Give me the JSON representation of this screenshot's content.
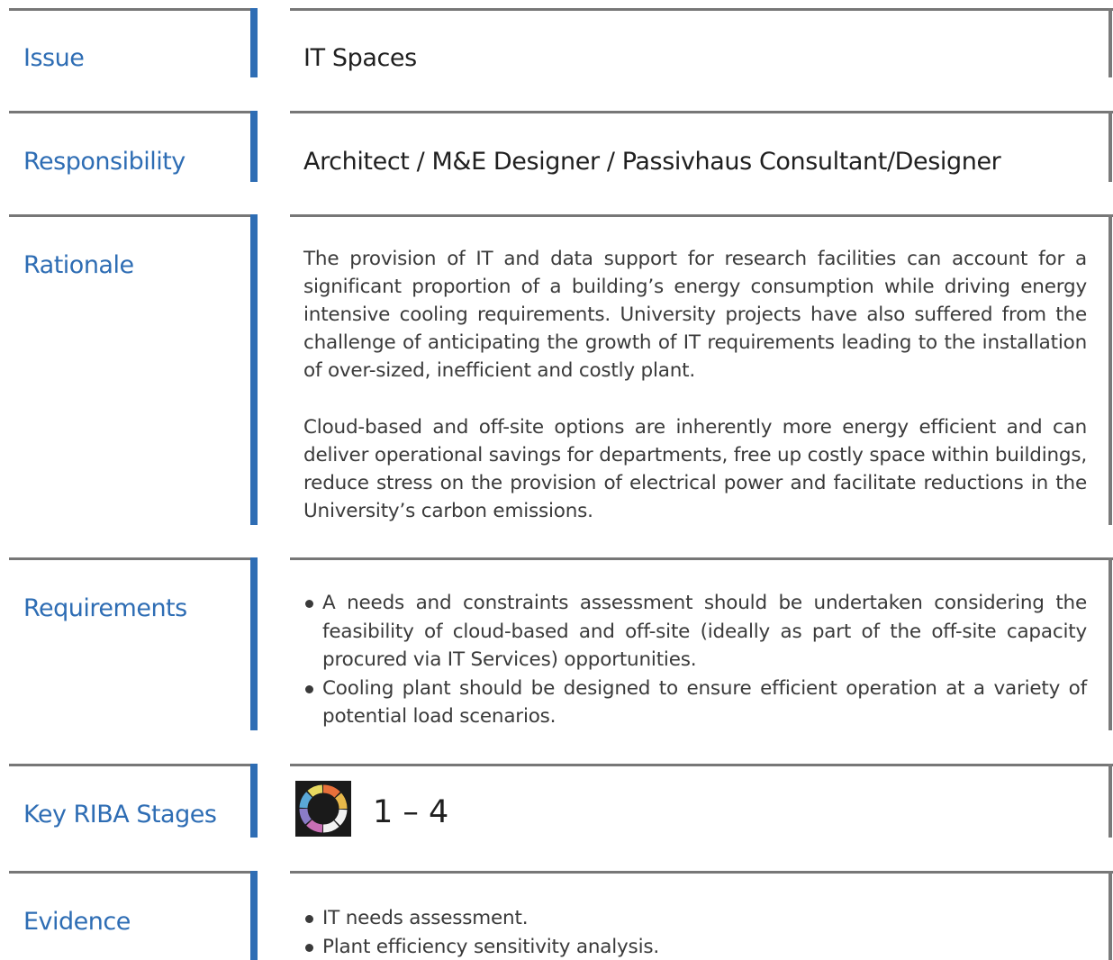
{
  "colors": {
    "label_blue": "#2e6db4",
    "divider_gray": "#777777",
    "body_text": "#3a3a3a"
  },
  "rows": {
    "issue": {
      "label": "Issue",
      "value": "IT Spaces"
    },
    "responsibility": {
      "label": "Responsibility",
      "value": "Architect / M&E Designer / Passivhaus Consultant/Designer"
    },
    "rationale": {
      "label": "Rationale",
      "paragraphs": [
        "The provision of IT and data support for research facilities can account for a significant proportion of a building’s energy consumption while driving energy intensive cooling requirements.  University projects have also suffered from the challenge of anticipating the growth of IT requirements leading to the installation of over-sized, inefficient and costly plant.",
        "Cloud-based and off-site options are inherently more energy efficient and can deliver operational savings for departments, free up costly space within buildings, reduce stress on the provision of electrical power and facilitate reductions in the University’s carbon emissions."
      ]
    },
    "requirements": {
      "label": "Requirements",
      "items": [
        "A needs and constraints assessment should be undertaken considering the feasibility of cloud-based and off-site (ideally as part of the off-site capacity procured via IT Services) opportunities.",
        "Cooling plant should be designed to ensure efficient operation at a variety of potential load scenarios."
      ]
    },
    "riba": {
      "label": "Key RIBA Stages",
      "icon": "riba-plan-of-work-wheel-icon",
      "stages": "1 – 4"
    },
    "evidence": {
      "label": "Evidence",
      "items": [
        "IT needs assessment.",
        "Plant efficiency sensitivity analysis."
      ]
    }
  }
}
